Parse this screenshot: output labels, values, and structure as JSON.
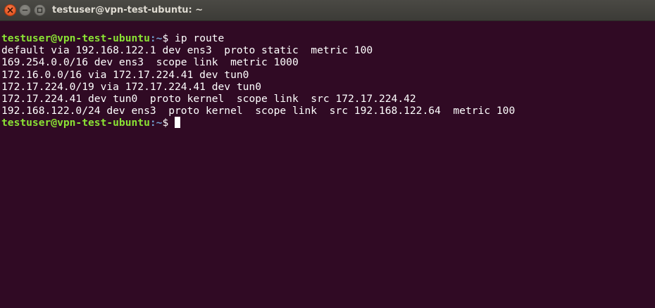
{
  "window": {
    "title": "testuser@vpn-test-ubuntu: ~"
  },
  "terminal": {
    "prompt_user": "testuser@vpn-test-ubuntu",
    "prompt_colon": ":",
    "prompt_path": "~",
    "prompt_symbol": "$ ",
    "command": "ip route",
    "output": [
      "default via 192.168.122.1 dev ens3  proto static  metric 100",
      "169.254.0.0/16 dev ens3  scope link  metric 1000",
      "172.16.0.0/16 via 172.17.224.41 dev tun0",
      "172.17.224.0/19 via 172.17.224.41 dev tun0",
      "172.17.224.41 dev tun0  proto kernel  scope link  src 172.17.224.42",
      "192.168.122.0/24 dev ens3  proto kernel  scope link  src 192.168.122.64  metric 100"
    ]
  },
  "colors": {
    "background": "#300a24",
    "prompt_user": "#8ae234",
    "prompt_path": "#729fcf",
    "text": "#ffffff",
    "close_button": "#df4a16"
  },
  "icons": {
    "close": "close-icon",
    "minimize": "minimize-icon",
    "maximize": "maximize-icon"
  }
}
